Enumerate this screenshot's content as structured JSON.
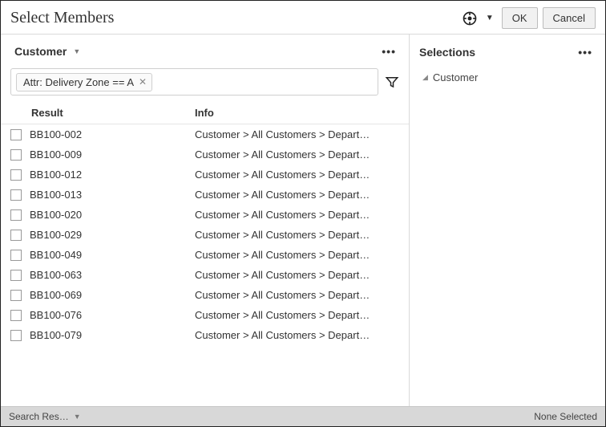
{
  "header": {
    "title": "Select Members",
    "ok_label": "OK",
    "cancel_label": "Cancel"
  },
  "left": {
    "dimension_label": "Customer",
    "chip_label": "Attr: Delivery Zone == A",
    "col_result": "Result",
    "col_info": "Info",
    "rows": [
      {
        "result": "BB100-002",
        "info": "Customer > All Customers > Depart…"
      },
      {
        "result": "BB100-009",
        "info": "Customer > All Customers > Depart…"
      },
      {
        "result": "BB100-012",
        "info": "Customer > All Customers > Depart…"
      },
      {
        "result": "BB100-013",
        "info": "Customer > All Customers > Depart…"
      },
      {
        "result": "BB100-020",
        "info": "Customer > All Customers > Depart…"
      },
      {
        "result": "BB100-029",
        "info": "Customer > All Customers > Depart…"
      },
      {
        "result": "BB100-049",
        "info": "Customer > All Customers > Depart…"
      },
      {
        "result": "BB100-063",
        "info": "Customer > All Customers > Depart…"
      },
      {
        "result": "BB100-069",
        "info": "Customer > All Customers > Depart…"
      },
      {
        "result": "BB100-076",
        "info": "Customer > All Customers > Depart…"
      },
      {
        "result": "BB100-079",
        "info": "Customer > All Customers > Depart…"
      }
    ]
  },
  "right": {
    "title": "Selections",
    "item_label": "Customer"
  },
  "footer": {
    "left_label": "Search Res…",
    "right_label": "None Selected"
  }
}
